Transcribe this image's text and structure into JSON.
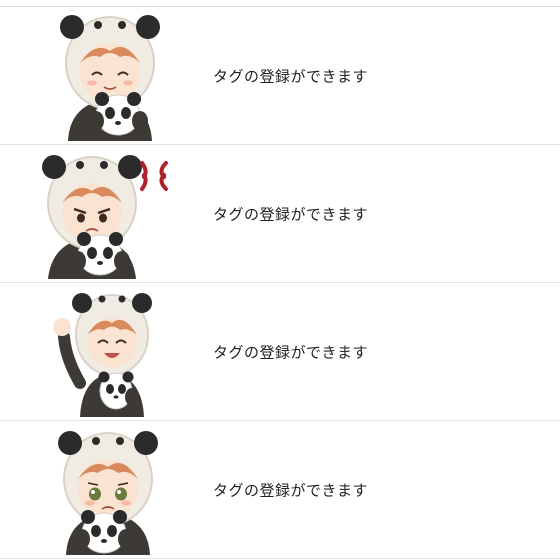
{
  "stickers": [
    {
      "caption": "タグの登録ができます",
      "expression": "smile"
    },
    {
      "caption": "タグの登録ができます",
      "expression": "angry"
    },
    {
      "caption": "タグの登録ができます",
      "expression": "wave"
    },
    {
      "caption": "タグの登録ができます",
      "expression": "teary"
    }
  ],
  "colors": {
    "hood": "#f1ece3",
    "hood_shade": "#d9d2c4",
    "ear": "#2b2b2b",
    "hair": "#d98a5c",
    "skin": "#fbe3d2",
    "jacket": "#3d3a35",
    "anger_mark": "#b0202a",
    "divider": "#e4e4e4"
  }
}
